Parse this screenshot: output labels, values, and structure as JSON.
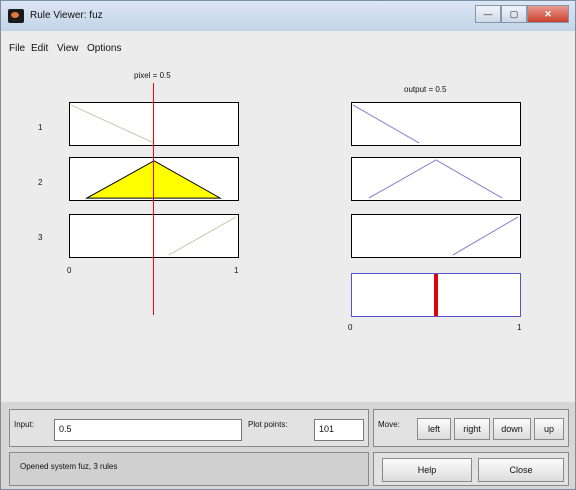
{
  "window": {
    "title": "Rule Viewer: fuz",
    "controls": [
      "—",
      "▢",
      "✕"
    ]
  },
  "menu": [
    "File",
    "Edit",
    "View",
    "Options"
  ],
  "input_panel": {
    "header": "pixel = 0.5",
    "rule_numbers": [
      "1",
      "2",
      "3"
    ],
    "axis_min": "0",
    "axis_max": "1"
  },
  "output_panel": {
    "header": "output = 0.5",
    "axis_min": "0",
    "axis_max": "1"
  },
  "bottom": {
    "input_label": "Input:",
    "input_value": "0.5",
    "plot_points_label": "Plot points:",
    "plot_points_value": "101",
    "move_label": "Move:",
    "move_buttons": [
      "left",
      "right",
      "down",
      "up"
    ],
    "status": "Opened system fuz, 3 rules",
    "help_label": "Help",
    "close_label": "Close"
  },
  "colors": {
    "input_mf": "#c8c8a8",
    "output_mf": "#8080c8",
    "fill": "#ffff00",
    "index_line": "#ff0000",
    "aggregate_border": "#5555cc"
  }
}
